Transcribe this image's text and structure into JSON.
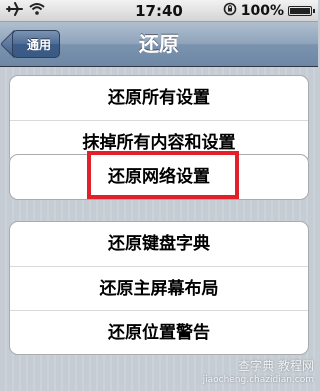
{
  "status_bar": {
    "time": "17:40",
    "battery": "100%",
    "airplane_icon": "airplane-icon",
    "wifi_icon": "wifi-icon",
    "rotation_lock_icon": "rotation-lock-icon",
    "battery_icon": "battery-icon"
  },
  "nav": {
    "back_label": "通用",
    "title": "还原"
  },
  "groups": [
    {
      "items": [
        "还原所有设置",
        "抹掉所有内容和设置"
      ]
    },
    {
      "items": [
        "还原网络设置"
      ]
    },
    {
      "items": [
        "还原键盘字典",
        "还原主屏幕布局",
        "还原位置警告"
      ]
    }
  ],
  "highlight_color": "#e1202a",
  "watermark": {
    "line1": "查字典 教程网",
    "line2": "jiaocheng.chazidian.com"
  }
}
